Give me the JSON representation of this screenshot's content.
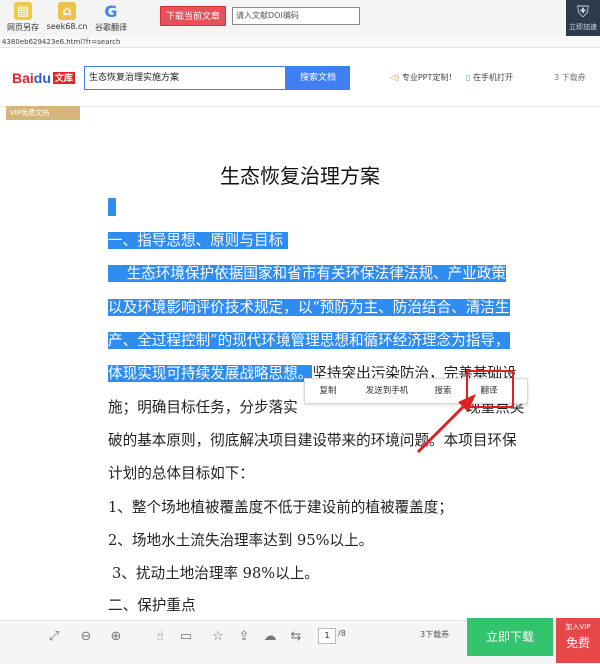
{
  "browser": {
    "bookmarks": [
      {
        "label": "网页另存",
        "icon": "save-page-icon"
      },
      {
        "label": "seek68.cn",
        "icon": "home-icon"
      },
      {
        "label": "谷歌翻译",
        "icon": "google-g-icon"
      }
    ],
    "download_button": "下载当前文章",
    "doi_placeholder": "请入文献DOI编码",
    "url": "4380eb629423e6.html?fr=search",
    "shield_label": "立即加速"
  },
  "header": {
    "logo_text": "Bai",
    "logo_paw": "du",
    "logo_wenku": "文库",
    "search_value": "生态恢复治理实施方案",
    "search_button": "搜索文档",
    "links": [
      "专业PPT定制！",
      "在手机打开"
    ],
    "download_count": "3 下载券"
  },
  "vip_badge": "VIP免费文档",
  "document": {
    "title": "生态恢复治理方案",
    "heading1": "一、指导思想、原则与目标",
    "para_lines_highlighted": [
      "生态环境保护依据国家和省市有关环保法律法规、产业政策",
      "以及环境影响评价技术规定，以“预防为主、防治结合、清洁生",
      "产、全过程控制”的现代环境管理思想和循环经济理念为指导，",
      "体现实现可持续发展战略思想。"
    ],
    "para_line4_rest": "坚持突出污染防治，完善基础设",
    "para_line5_start": "施；明确目标任务，分步落实",
    "para_line5_end": "现重点突",
    "para_line6": "破的基本原则，彻底解决项目建设带来的环境问题。本项目环保",
    "para_line7": "计划的总体目标如下：",
    "goal1": "1、整个场地植被覆盖度不低于建设前的植被覆盖度；",
    "goal2": "2、场地水土流失治理率达到 95%以上。",
    "goal3": "3、扰动土地治理率 98%以上。",
    "heading2": "二、保护重点"
  },
  "context_menu": [
    "复制",
    "发送到手机",
    "搜索",
    "翻译"
  ],
  "bottom": {
    "page_current": "1",
    "page_total": "/8",
    "download_count": "3下载券",
    "download_button": "立即下载",
    "free_top": "加入VIP",
    "free_label": "免费"
  },
  "colors": {
    "highlight": "#2f8cf0",
    "download_green": "#34c46e",
    "free_red": "#e8474a",
    "annotation_red": "#e02020"
  }
}
